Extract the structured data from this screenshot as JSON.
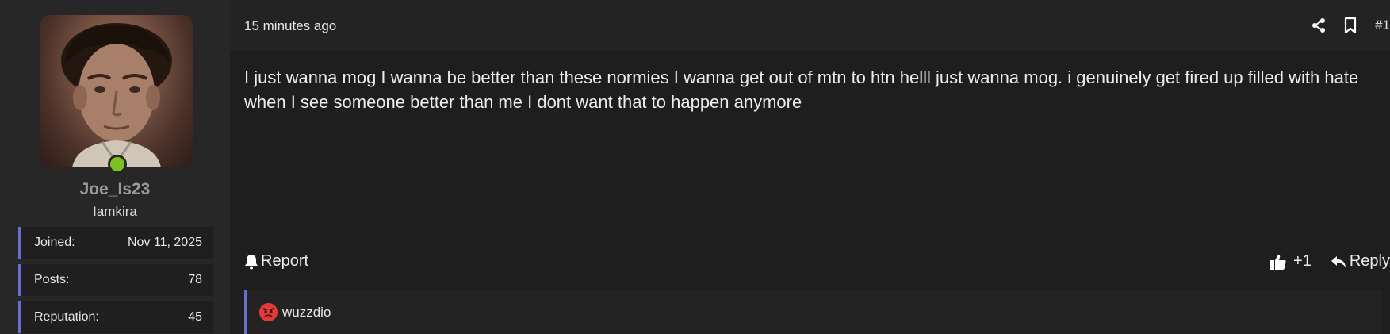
{
  "author": {
    "username": "Joe_Is23",
    "title": "Iamkira",
    "online_color": "#7cc21a",
    "stats": [
      {
        "label": "Joined:",
        "value": "Nov 11, 2025"
      },
      {
        "label": "Posts:",
        "value": "78"
      },
      {
        "label": "Reputation:",
        "value": "45"
      }
    ]
  },
  "post": {
    "timestamp": "15 minutes ago",
    "number": "#1",
    "body": "I just wanna mog I wanna be better than these normies I wanna get out of mtn to htn helll just wanna mog. i genuinely get fired up filled with hate when I see someone better than me I dont want that to happen anymore",
    "header_icons": [
      "share-icon",
      "bookmark-icon"
    ]
  },
  "actions": {
    "report_label": "Report",
    "like_count": "+1",
    "reply_label": "Reply"
  },
  "reactions": {
    "users": [
      {
        "icon": "angry-face-icon",
        "name": "wuzzdio"
      }
    ]
  },
  "colors": {
    "accent": "#6b6ed1",
    "background": "#1e1e1e",
    "sidebar": "#272727"
  }
}
